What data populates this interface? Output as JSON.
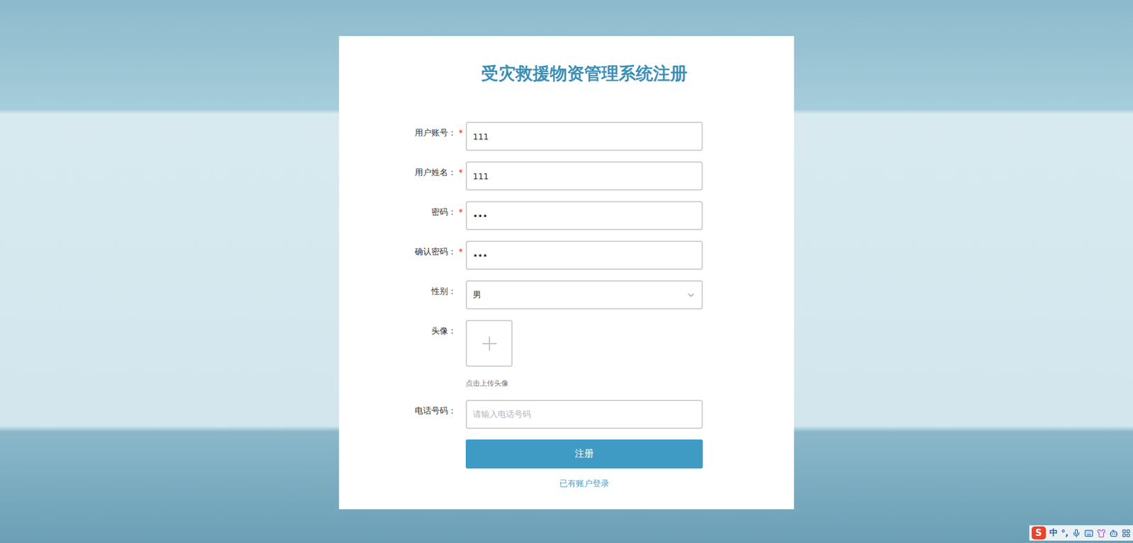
{
  "title": "受灾救援物资管理系统注册",
  "fields": [
    {
      "kind": "text",
      "label": "用户账号：",
      "required": true,
      "value": "111",
      "placeholder": ""
    },
    {
      "kind": "text",
      "label": "用户姓名：",
      "required": true,
      "value": "111",
      "placeholder": ""
    },
    {
      "kind": "text",
      "label": "密码：",
      "required": true,
      "value": "•••",
      "placeholder": ""
    },
    {
      "kind": "text",
      "label": "确认密码：",
      "required": true,
      "value": "•••",
      "placeholder": ""
    },
    {
      "kind": "select",
      "label": "性别：",
      "required": false,
      "value": "男",
      "placeholder": ""
    },
    {
      "kind": "upload",
      "label": "头像：",
      "required": false,
      "value": "点击上传头像",
      "placeholder": ""
    },
    {
      "kind": "text",
      "label": "电话号码：",
      "required": false,
      "value": "",
      "placeholder": "请输入电话号码"
    }
  ],
  "submit": "注册",
  "login_link": "已有账户登录",
  "ime_toolbar": {
    "logo": "S",
    "mode": "中",
    "punct": "°,"
  }
}
